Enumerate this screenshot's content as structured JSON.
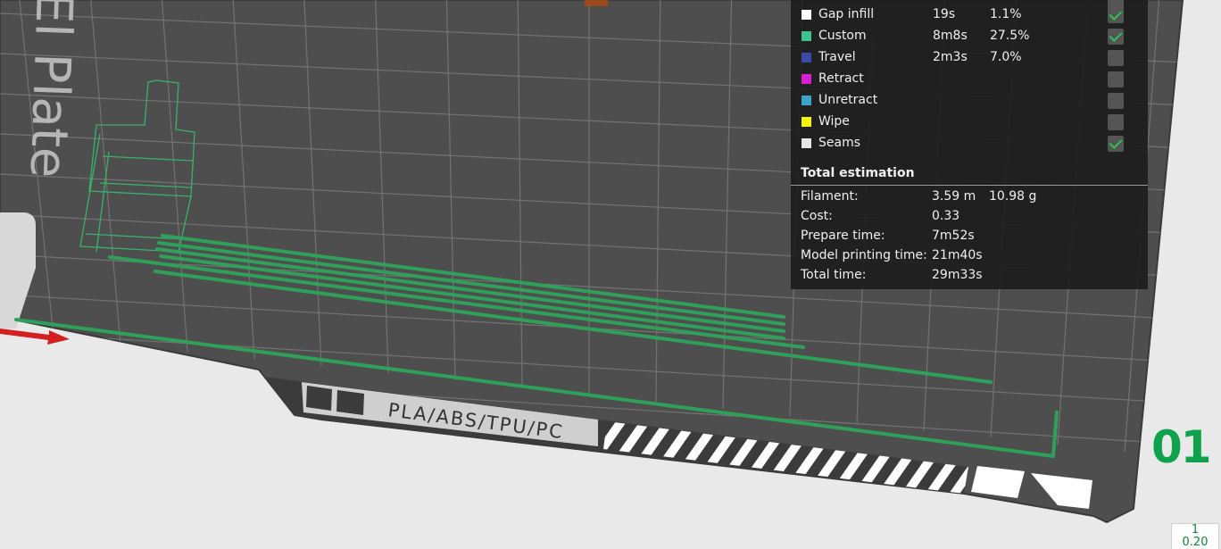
{
  "legend": {
    "rows": [
      {
        "name": "Gap infill",
        "time": "19s",
        "percent": "1.1%",
        "color": "#ffffff",
        "checked": true
      },
      {
        "name": "Custom",
        "time": "8m8s",
        "percent": "27.5%",
        "color": "#3ec38a",
        "checked": true
      },
      {
        "name": "Travel",
        "time": "2m3s",
        "percent": "7.0%",
        "color": "#3a4aa8",
        "checked": false
      },
      {
        "name": "Retract",
        "time": "",
        "percent": "",
        "color": "#d81ed8",
        "checked": false
      },
      {
        "name": "Unretract",
        "time": "",
        "percent": "",
        "color": "#3aa5c8",
        "checked": false
      },
      {
        "name": "Wipe",
        "time": "",
        "percent": "",
        "color": "#f2f20a",
        "checked": false
      },
      {
        "name": "Seams",
        "time": "",
        "percent": "",
        "color": "#e6e6e6",
        "checked": true
      }
    ]
  },
  "estimation": {
    "title": "Total estimation",
    "filament_label": "Filament:",
    "filament_length": "3.59 m",
    "filament_weight": "10.98 g",
    "cost_label": "Cost:",
    "cost": "0.33",
    "prepare_label": "Prepare time:",
    "prepare_time": "7m52s",
    "model_label": "Model printing time:",
    "model_time": "21m40s",
    "total_label": "Total time:",
    "total_time": "29m33s"
  },
  "plate": {
    "number": "01",
    "bed_side_text": "El Plate",
    "bed_material_text": "PLA/ABS/TPU/PC"
  },
  "layer_slider": {
    "top_value": "1",
    "bottom_value": "0.20"
  },
  "colors": {
    "accent_green": "#0da24b",
    "toolpath_green": "#2fa05a",
    "bed_gray": "#4e4e4e",
    "panel_bg": "#1c1c1c"
  }
}
